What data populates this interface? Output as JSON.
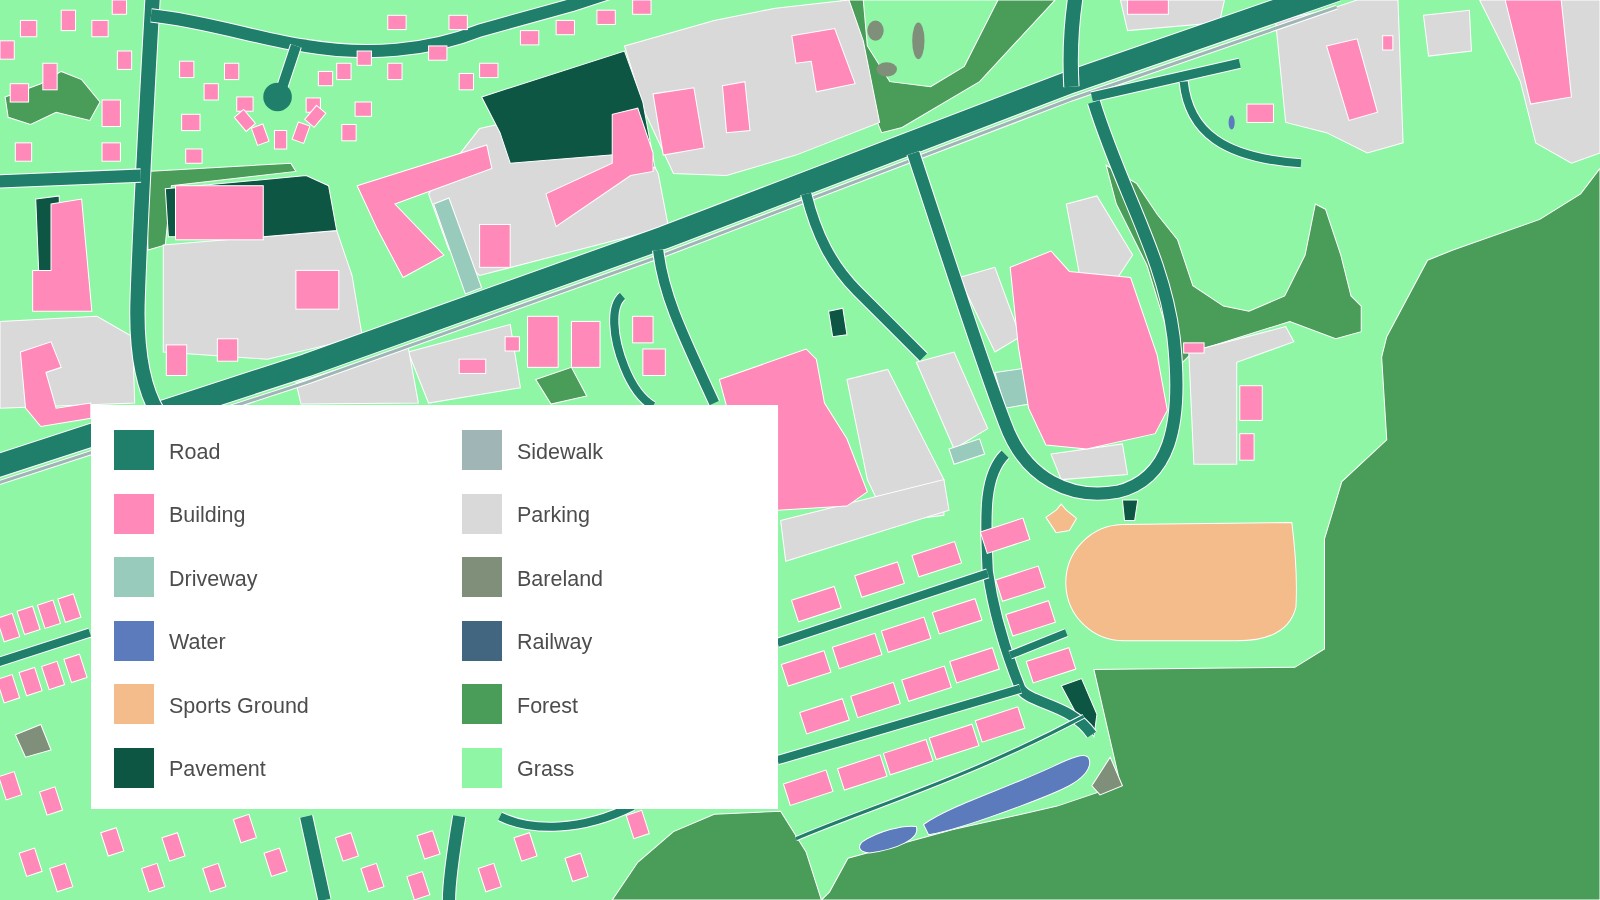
{
  "legend": {
    "items": [
      {
        "label": "Road",
        "color": "#1f7f6b"
      },
      {
        "label": "Sidewalk",
        "color": "#a0b6b6"
      },
      {
        "label": "Building",
        "color": "#ff8ab9"
      },
      {
        "label": "Parking",
        "color": "#d9d9d9"
      },
      {
        "label": "Driveway",
        "color": "#99cbbd"
      },
      {
        "label": "Bareland",
        "color": "#7f8f7a"
      },
      {
        "label": "Water",
        "color": "#5b7bbd"
      },
      {
        "label": "Railway",
        "color": "#426580"
      },
      {
        "label": "Sports Ground",
        "color": "#f4bc8a"
      },
      {
        "label": "Forest",
        "color": "#4a9c59"
      },
      {
        "label": "Pavement",
        "color": "#0e5644"
      },
      {
        "label": "Grass",
        "color": "#8ff6a6"
      }
    ]
  }
}
